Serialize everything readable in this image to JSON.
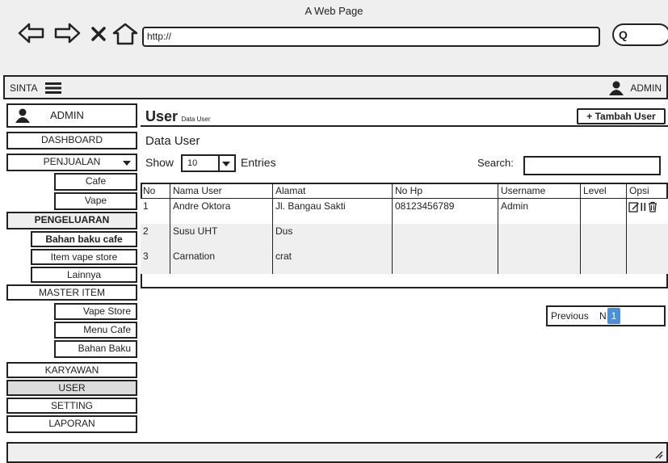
{
  "browser": {
    "title": "A Web Page",
    "url": "http://",
    "search_glyph": "Q"
  },
  "appbar": {
    "brand": "SINTA",
    "user": "ADMIN"
  },
  "sidebar": {
    "header": "ADMIN",
    "items": [
      {
        "label": "DASHBOARD"
      },
      {
        "label": "PENJUALAN"
      },
      {
        "label": "Cafe"
      },
      {
        "label": "Vape"
      },
      {
        "label": "PENGELUARAN"
      },
      {
        "label": "Bahan baku cafe"
      },
      {
        "label": "Item vape store"
      },
      {
        "label": "Lainnya"
      },
      {
        "label": "MASTER ITEM"
      },
      {
        "label": "Vape Store"
      },
      {
        "label": "Menu Cafe"
      },
      {
        "label": "Bahan Baku"
      },
      {
        "label": "KARYAWAN"
      },
      {
        "label": "USER"
      },
      {
        "label": "SETTING"
      },
      {
        "label": "LAPORAN"
      }
    ]
  },
  "main": {
    "title": "User",
    "subtitle": "Data User",
    "add_button": "+ Tambah User",
    "section_title": "Data User",
    "show_label": "Show",
    "entries_value": "10",
    "entries_label": "Entries",
    "search_label": "Search:",
    "search_value": ""
  },
  "table": {
    "columns": [
      "No",
      "Nama User",
      "Alamat",
      "No Hp",
      "Username",
      "Level",
      "Opsi"
    ],
    "rows": [
      [
        "1",
        "Andre Oktora",
        "Jl. Bangau Sakti",
        "08123456789",
        "Admin",
        "",
        ""
      ],
      [
        "2",
        "Susu UHT",
        "Dus",
        "",
        "",
        "",
        ""
      ],
      [
        "3",
        "Carnation",
        "crat",
        "",
        "",
        "",
        ""
      ]
    ]
  },
  "pager": {
    "prev": "Previous",
    "next": "N",
    "page": "1"
  },
  "icons": [
    "back-arrow-icon",
    "forward-arrow-icon",
    "close-icon",
    "home-icon",
    "search-icon",
    "hamburger-menu-icon",
    "user-icon",
    "edit-icon",
    "pause-icon",
    "trash-icon",
    "resize-grip-icon"
  ],
  "colors": {
    "page_btn": "#4a90d9"
  }
}
